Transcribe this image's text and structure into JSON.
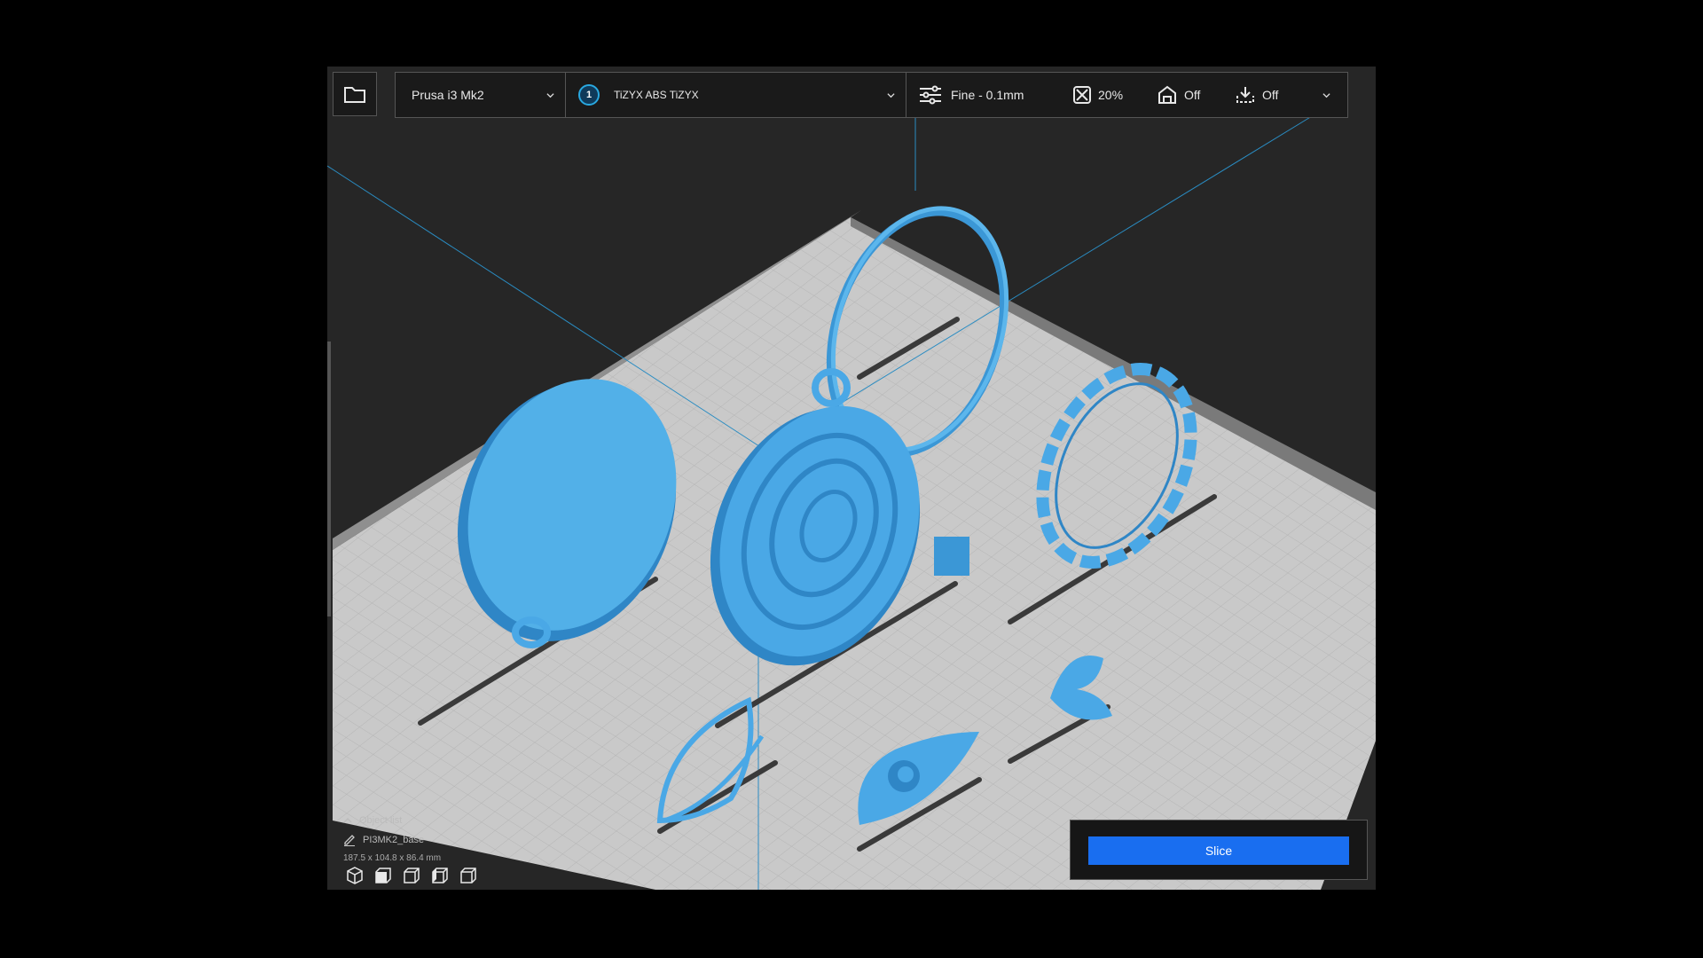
{
  "toolbar": {
    "printer": "Prusa i3 Mk2",
    "material_index": "1",
    "material": "TiZYX ABS TiZYX",
    "profile": "Fine - 0.1mm",
    "infill": "20%",
    "support": "Off",
    "adhesion": "Off"
  },
  "object_list": {
    "header": "Object list",
    "item": "PI3MK2_base",
    "dimensions": "187.5 x 104.8 x 86.4 mm"
  },
  "slice_button": "Slice",
  "icons": {
    "open": "folder-icon",
    "printer_dropdown": "chevron-down-icon",
    "profile": "sliders-icon",
    "infill": "infill-icon",
    "support": "support-icon",
    "adhesion": "adhesion-icon",
    "views": [
      "3d-view-icon",
      "front-view-icon",
      "top-view-icon",
      "left-view-icon",
      "right-view-icon"
    ]
  },
  "colors": {
    "model": "#4aa8e6",
    "build_plate": "#c8c8c8",
    "slice_button": "#196ef0",
    "background": "#262626"
  }
}
